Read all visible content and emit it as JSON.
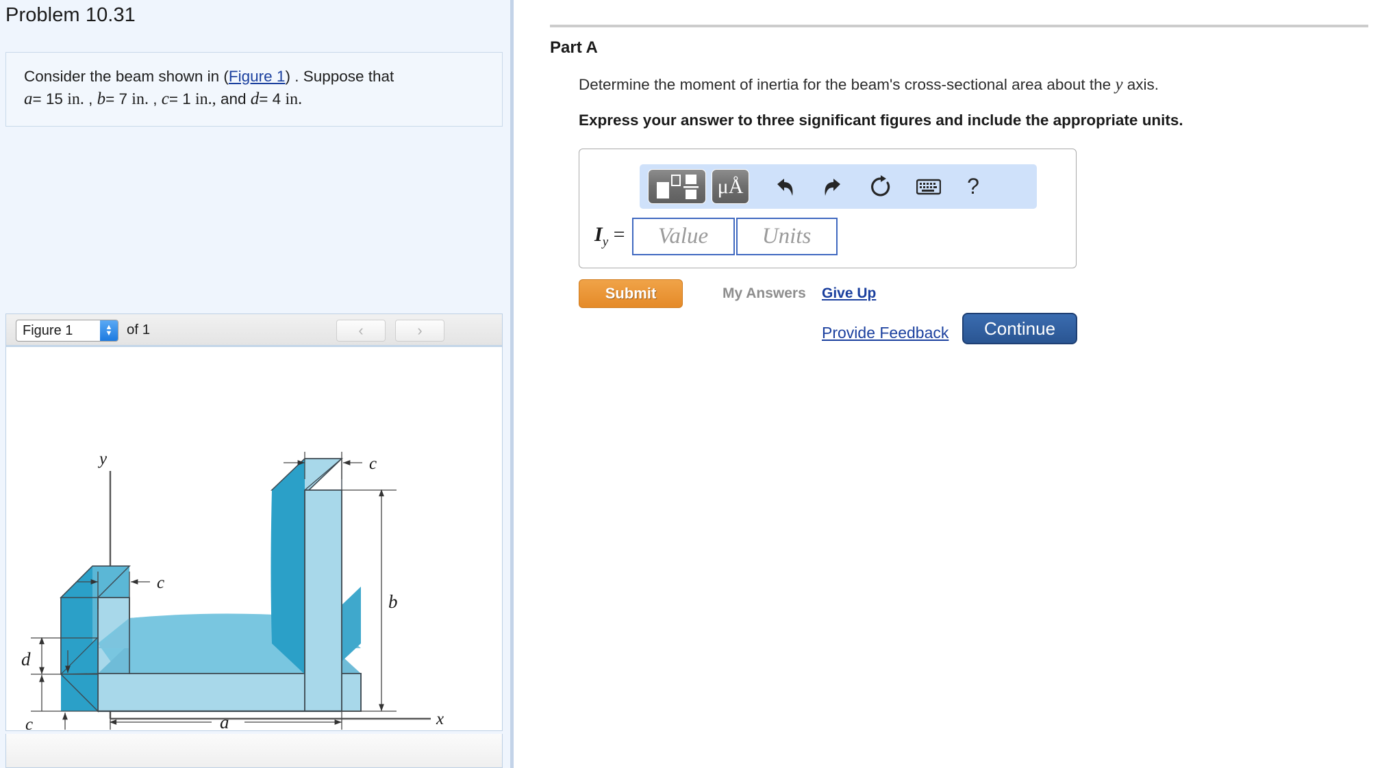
{
  "problem": {
    "title": "Problem 10.31",
    "statement_prefix": "Consider the beam shown in (",
    "figure_link": "Figure 1",
    "statement_suffix": ") . Suppose that",
    "givens": [
      {
        "var": "a",
        "eq": "= 15",
        "unit": "in."
      },
      {
        "var": "b",
        "eq": "= 7",
        "unit": "in."
      },
      {
        "var": "c",
        "eq": "= 1",
        "unit": "in.,"
      },
      {
        "var": "d",
        "eq": "= 4",
        "unit": "in."
      }
    ],
    "and_word": "and"
  },
  "figure_panel": {
    "selected_figure": "Figure 1",
    "count_label": "of 1",
    "prev_icon": "chevron-left-icon",
    "next_icon": "chevron-right-icon",
    "stepper_up": "▲",
    "stepper_down": "▼"
  },
  "figure": {
    "caption_labels": {
      "y_axis": "y",
      "x_axis": "x",
      "length_a": "a",
      "height_b": "b",
      "thickness_c": "c",
      "depth_d": "d"
    },
    "colors": {
      "face_front": "#a9d6e8",
      "face_top": "#79c6e0",
      "face_side": "#2ba0c8",
      "face_inner": "#6cb8d4",
      "outline": "#3d4850"
    }
  },
  "part_a": {
    "heading": "Part A",
    "question_before": "Determine the moment of inertia for the beam's cross-sectional area about the ",
    "question_var": "y",
    "question_after": " axis.",
    "instruction": "Express your answer to three significant figures and include the appropriate units."
  },
  "math_toolbar": {
    "template_button": "template-palette-icon",
    "units_button_label": "μÅ",
    "undo_icon": "undo-arrow-icon",
    "redo_icon": "redo-arrow-icon",
    "reset_icon": "reset-circular-arrow-icon",
    "keyboard_icon": "keyboard-icon",
    "help_label": "?"
  },
  "answer": {
    "symbol": "I",
    "subscript": "y",
    "equals": "=",
    "value_placeholder": "Value",
    "units_placeholder": "Units"
  },
  "actions": {
    "submit_label": "Submit",
    "my_answers_label": "My Answers",
    "give_up_label": "Give Up",
    "provide_feedback_label": "Provide Feedback",
    "continue_label": "Continue"
  },
  "colors": {
    "left_panel_bg": "#eff5fd",
    "submit_orange": "#e58a28",
    "continue_blue": "#2a5592",
    "link_blue": "#1a3f9e",
    "toolbar_blue": "#cfe1fa"
  }
}
